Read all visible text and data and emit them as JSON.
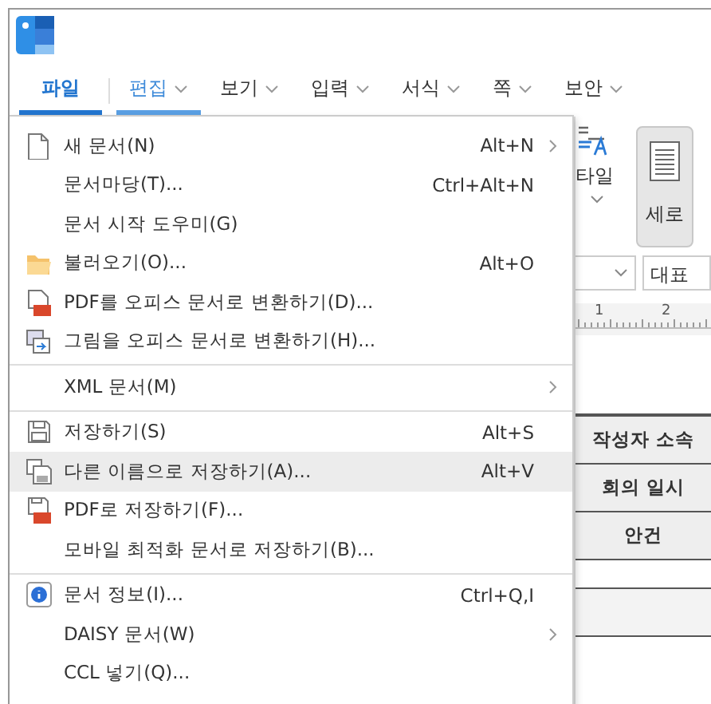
{
  "menu_tabs": [
    {
      "label": "파일",
      "selected": true,
      "hovered": false,
      "dropdown": false
    },
    {
      "label": "편집",
      "selected": false,
      "hovered": true,
      "dropdown": true
    },
    {
      "label": "보기",
      "selected": false,
      "hovered": false,
      "dropdown": true
    },
    {
      "label": "입력",
      "selected": false,
      "hovered": false,
      "dropdown": true
    },
    {
      "label": "서식",
      "selected": false,
      "hovered": false,
      "dropdown": true
    },
    {
      "label": "쪽",
      "selected": false,
      "hovered": false,
      "dropdown": true
    },
    {
      "label": "보안",
      "selected": false,
      "hovered": false,
      "dropdown": true
    }
  ],
  "ribbon": {
    "style_label": "타일",
    "orientation_button": {
      "label": "세로",
      "selected": true
    },
    "style_field": "대표",
    "ruler_marks": [
      "1",
      "2"
    ]
  },
  "document_table": {
    "rows": [
      {
        "label": "작성자 소속"
      },
      {
        "label": "회의 일시"
      },
      {
        "label": "안건"
      },
      {
        "label": ""
      },
      {
        "label": ""
      }
    ]
  },
  "file_menu": {
    "items": [
      {
        "kind": "item",
        "label": "새 문서(N)",
        "shortcut": "Alt+N",
        "submenu": true,
        "highlighted": false
      },
      {
        "kind": "item",
        "label": "문서마당(T)...",
        "shortcut": "Ctrl+Alt+N",
        "submenu": false,
        "highlighted": false
      },
      {
        "kind": "item",
        "label": "문서 시작 도우미(G)",
        "submenu": false,
        "highlighted": false
      },
      {
        "kind": "item",
        "label": "불러오기(O)...",
        "shortcut": "Alt+O",
        "submenu": false,
        "highlighted": false
      },
      {
        "kind": "item",
        "label": "PDF를 오피스 문서로 변환하기(D)...",
        "submenu": false,
        "highlighted": false
      },
      {
        "kind": "item",
        "label": "그림을 오피스 문서로 변환하기(H)...",
        "submenu": false,
        "highlighted": false
      },
      {
        "kind": "separator"
      },
      {
        "kind": "item",
        "label": "XML 문서(M)",
        "submenu": true,
        "highlighted": false
      },
      {
        "kind": "separator"
      },
      {
        "kind": "item",
        "label": "저장하기(S)",
        "shortcut": "Alt+S",
        "submenu": false,
        "highlighted": false
      },
      {
        "kind": "item",
        "label": "다른 이름으로 저장하기(A)...",
        "shortcut": "Alt+V",
        "submenu": false,
        "highlighted": true
      },
      {
        "kind": "item",
        "label": "PDF로 저장하기(F)...",
        "submenu": false,
        "highlighted": false
      },
      {
        "kind": "item",
        "label": "모바일 최적화 문서로 저장하기(B)...",
        "submenu": false,
        "highlighted": false
      },
      {
        "kind": "separator"
      },
      {
        "kind": "item",
        "label": "문서 정보(I)...",
        "shortcut": "Ctrl+Q,I",
        "submenu": false,
        "highlighted": false
      },
      {
        "kind": "item",
        "label": "DAISY 문서(W)",
        "submenu": true,
        "highlighted": false
      },
      {
        "kind": "item",
        "label": "CCL 넣기(Q)...",
        "submenu": false,
        "highlighted": false
      }
    ]
  }
}
